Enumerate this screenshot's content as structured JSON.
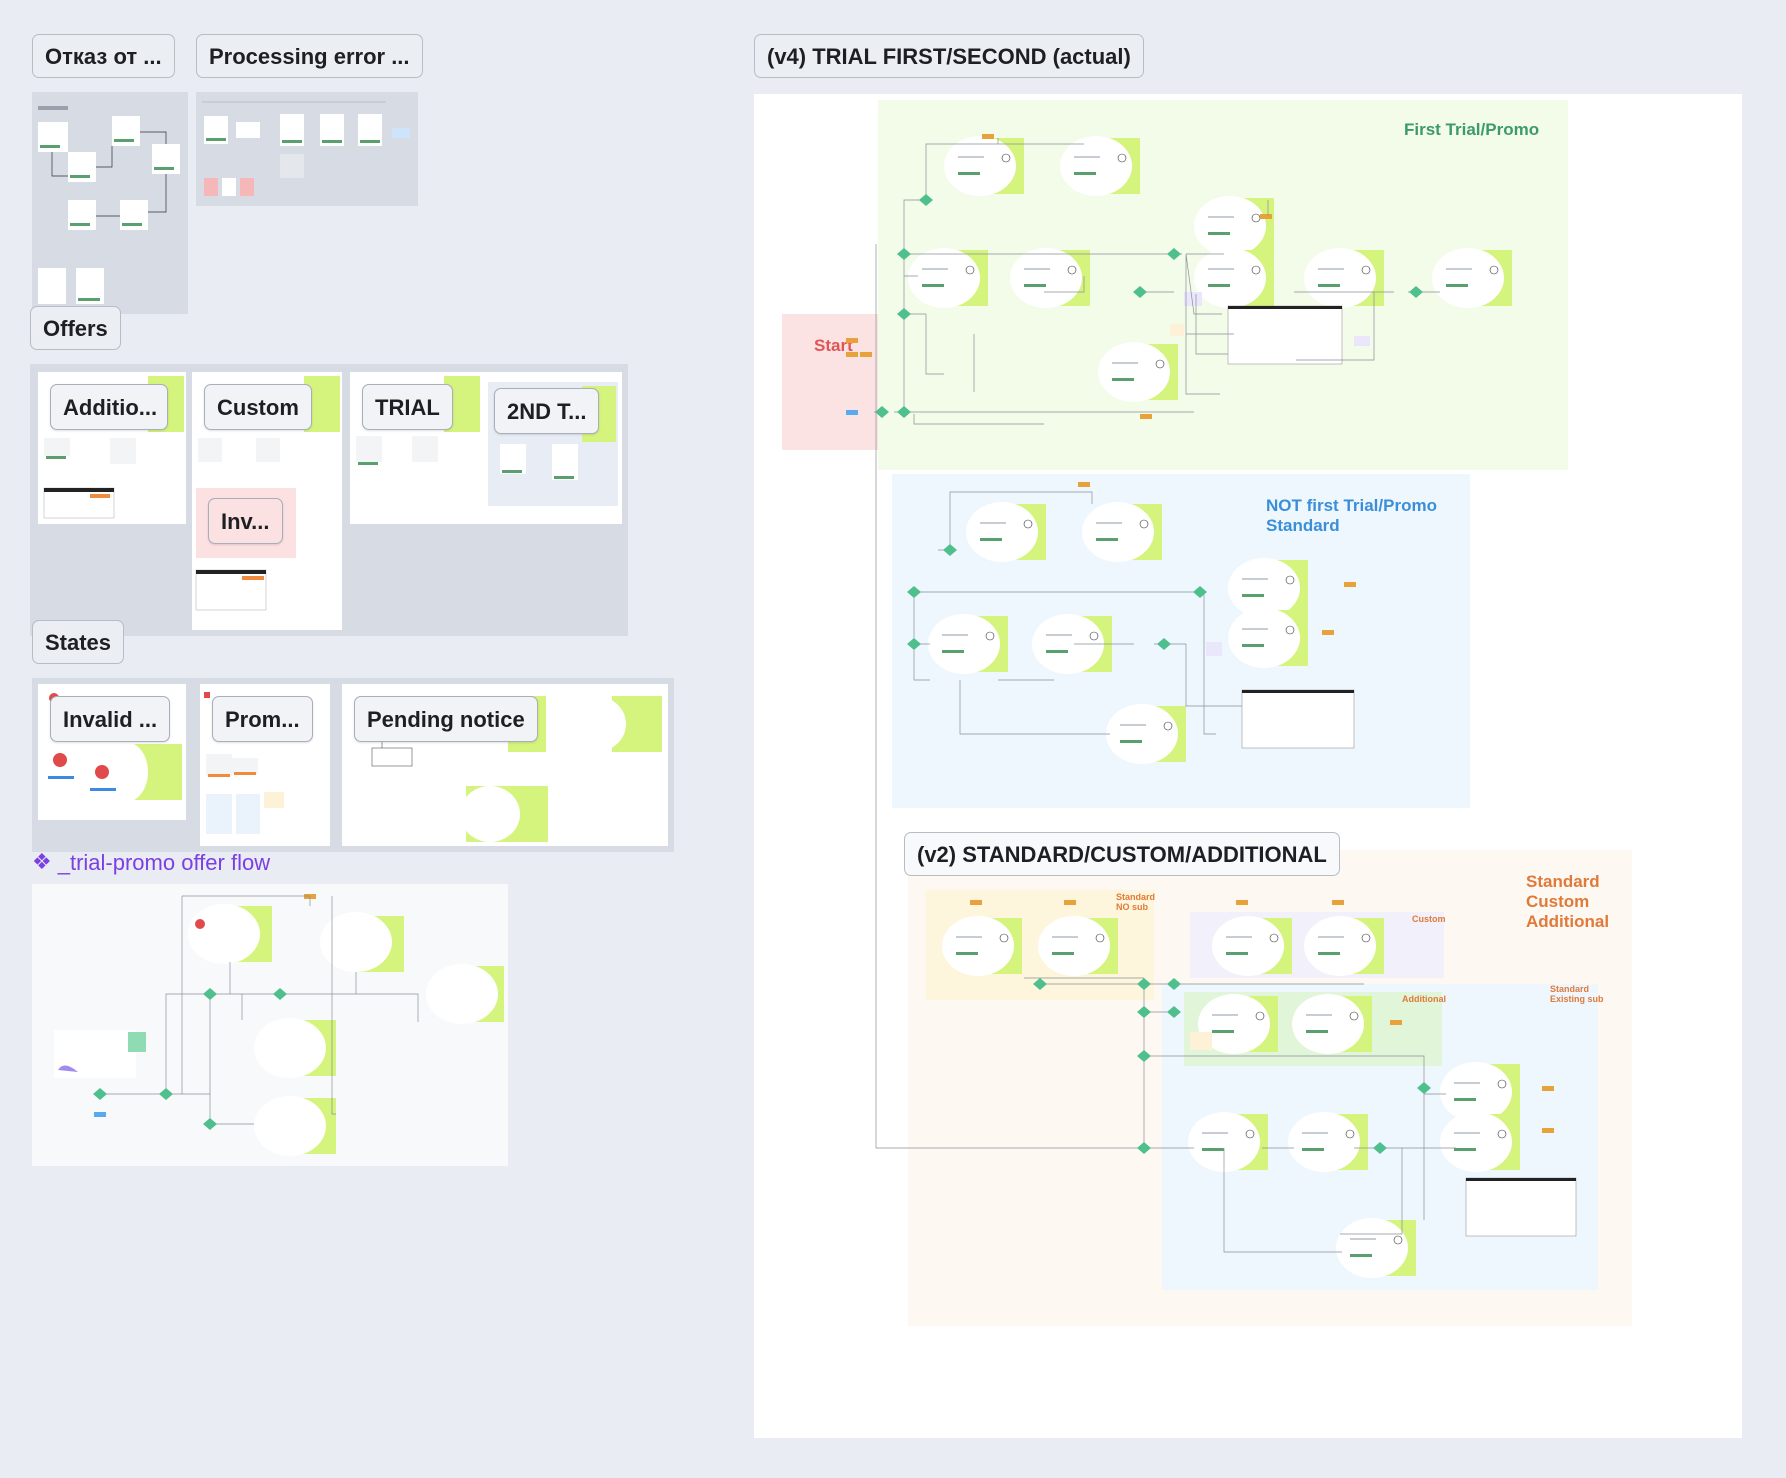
{
  "labels": {
    "otkaz": "Отказ от ...",
    "processing_error": "Processing error ...",
    "offers": "Offers",
    "additional": "Additio...",
    "custom": "Custom",
    "trial": "TRIAL",
    "second_trial": "2ND T...",
    "invalid_small": "Inv...",
    "states": "States",
    "invalid": "Invalid ...",
    "promo": "Prom...",
    "pending_notice": "Pending notice",
    "trial_promo_flow": "_trial-promo offer flow",
    "v4_trial": "(v4) TRIAL FIRST/SECOND (actual)",
    "v2_standard": "(v2) STANDARD/CUSTOM/ADDITIONAL"
  },
  "sections": {
    "first_trial": "First Trial/Promo",
    "not_first_trial_line1": "NOT first Trial/Promo",
    "not_first_trial_line2": "Standard",
    "start": "Start",
    "standard_custom_additional_line1": "Standard",
    "standard_custom_additional_line2": "Custom",
    "standard_custom_additional_line3": "Additional",
    "standard_no_sub_line1": "Standard",
    "standard_no_sub_line2": "NO sub",
    "custom": "Custom",
    "additional": "Additional",
    "standard_existing_sub_line1": "Standard",
    "standard_existing_sub_line2": "Existing sub"
  },
  "colors": {
    "canvas": "#e9ecf2",
    "green_section": "#f3fbe9",
    "green_title": "#3d9a6b",
    "blue_section": "#eef7fd",
    "blue_title": "#3b8fd8",
    "orange_section": "#fdf8f1",
    "orange_title": "#e07a3a",
    "start_section": "#fbe3e3",
    "start_title": "#e05555",
    "lime": "#d5f47e",
    "diamond": "#4fc08d",
    "purple_link": "#7b3fe4"
  },
  "icons": {
    "component_icon": "component-icon"
  }
}
